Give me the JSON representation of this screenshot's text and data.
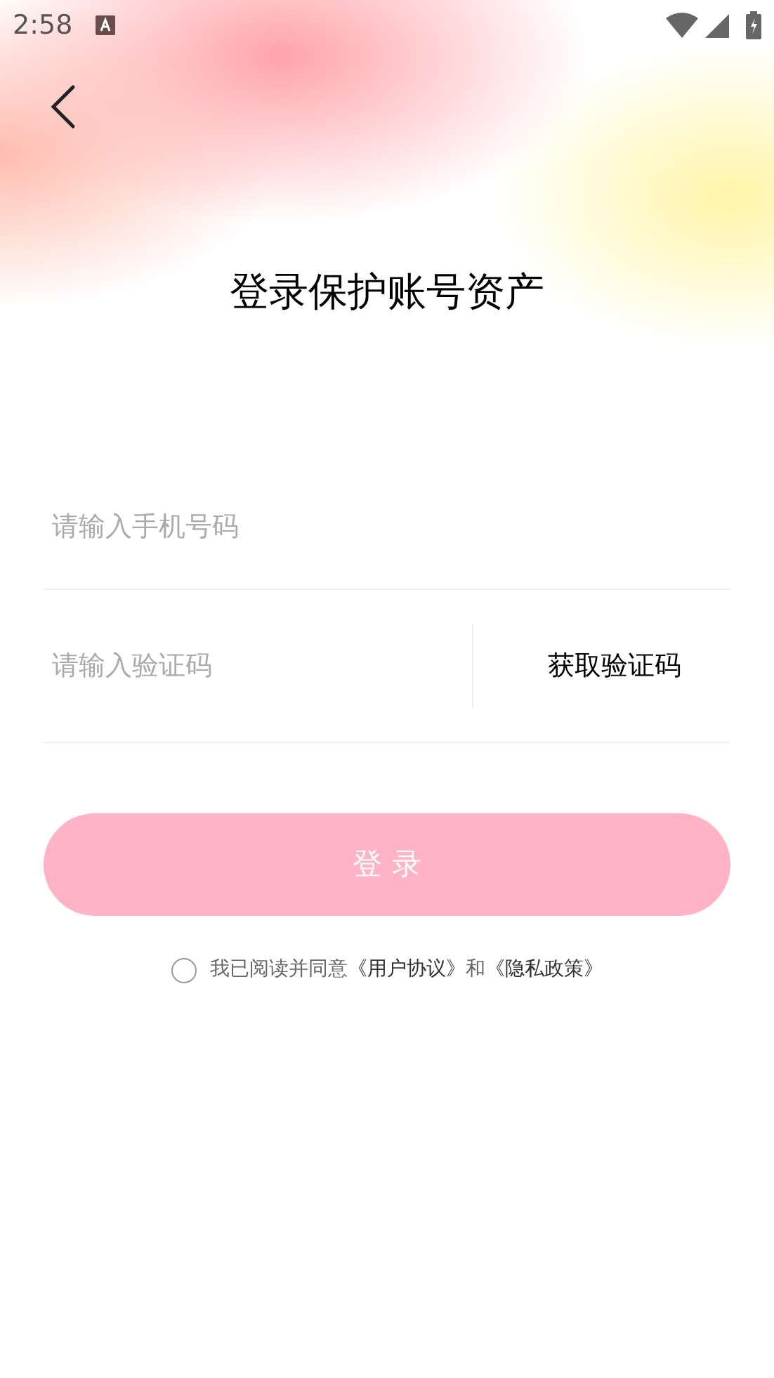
{
  "status_bar": {
    "time": "2:58"
  },
  "title": "登录保护账号资产",
  "phone_field": {
    "placeholder": "请输入手机号码"
  },
  "code_field": {
    "placeholder": "请输入验证码",
    "action": "获取验证码"
  },
  "login_button": {
    "label": "登 录",
    "disabled": true
  },
  "agreement": {
    "checked": false,
    "parts": [
      {
        "kind": "text",
        "text": "我已阅读并同意"
      },
      {
        "kind": "link",
        "text": "《用户协议》"
      },
      {
        "kind": "text",
        "text": "和"
      },
      {
        "kind": "link",
        "text": "《隐私政策》"
      }
    ]
  }
}
